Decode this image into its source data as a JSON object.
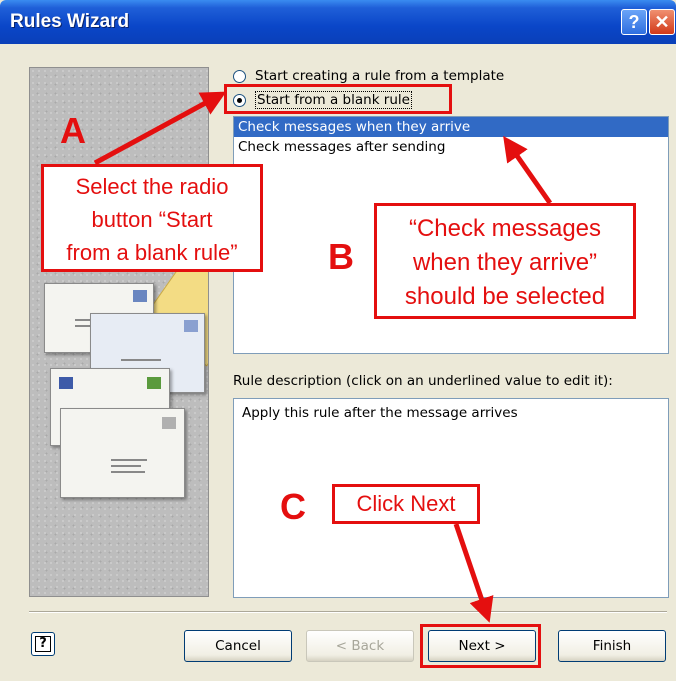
{
  "window": {
    "title": "Rules Wizard",
    "help_glyph": "?",
    "close_glyph": "✕"
  },
  "options": {
    "template_label": "Start creating a rule from a template",
    "blank_label": "Start from a blank rule"
  },
  "rule_list": {
    "items": [
      {
        "label": "Check messages when they arrive",
        "selected": true
      },
      {
        "label": "Check messages after sending",
        "selected": false
      }
    ]
  },
  "description": {
    "label": "Rule description (click on an underlined value to edit it):",
    "text": "Apply this rule after the message arrives"
  },
  "buttons": {
    "help_glyph": "?",
    "cancel": "Cancel",
    "back": "< Back",
    "next": "Next >",
    "finish": "Finish"
  },
  "annotations": {
    "letter_a": "A",
    "letter_b": "B",
    "letter_c": "C",
    "callout_a": [
      "Select the radio",
      "button “Start",
      "from a blank rule”"
    ],
    "callout_b": [
      "“Check messages",
      "when they arrive”",
      "should be selected"
    ],
    "callout_c": "Click Next",
    "color": "#e40f0f"
  }
}
